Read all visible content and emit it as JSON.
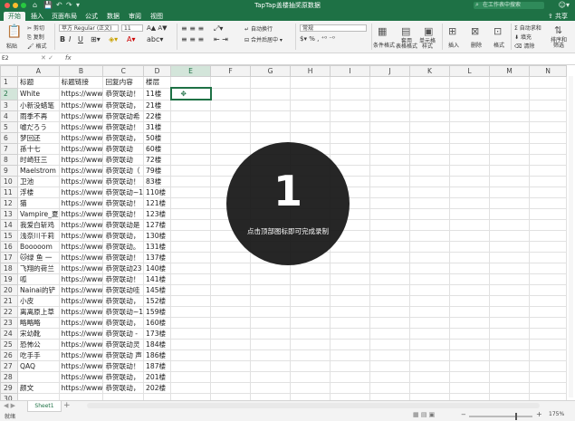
{
  "window": {
    "title": "TapTap盖楼抽奖原数据",
    "search_placeholder": "在工作表中搜索",
    "quick_access": [
      "⌂",
      "💾",
      "↶",
      "↷",
      "▾"
    ],
    "user_icon": "☺▾"
  },
  "tabs": [
    "开始",
    "插入",
    "页面布局",
    "公式",
    "数据",
    "审阅",
    "视图"
  ],
  "share_label": "⇪ 共享",
  "ribbon": {
    "paste": "粘贴",
    "cut": "剪切",
    "copy": "复制",
    "format_painter": "格式",
    "font_name": "苹方 Regular (正文)",
    "font_size": "11",
    "wrap": "自动换行",
    "merge": "合并后居中",
    "number_format": "常规",
    "cond_format": "条件格式",
    "table_format": "套用\n表格格式",
    "cell_styles": "单元格\n样式",
    "insert": "插入",
    "delete": "删除",
    "format": "格式",
    "autosum": "自动求和",
    "fill": "填充",
    "clear": "清除",
    "sort_filter": "排序和\n筛选"
  },
  "formula_bar": {
    "name_box": "E2",
    "fx": "fx",
    "formula": ""
  },
  "columns": [
    "A",
    "B",
    "C",
    "D",
    "E",
    "F",
    "G",
    "H",
    "I",
    "J",
    "K",
    "L",
    "M",
    "N"
  ],
  "rows": [
    {
      "n": "1",
      "a": "标题",
      "b": "标题链接",
      "c": "回复内容",
      "d": "楼层"
    },
    {
      "n": "2",
      "a": "White",
      "b": "https://www",
      "c": "恭贺联动！",
      "d": "11楼"
    },
    {
      "n": "3",
      "a": "小新没蜡笔",
      "b": "https://www",
      "c": "恭贺联动，",
      "d": "21楼"
    },
    {
      "n": "4",
      "a": "雨季不再",
      "b": "https://www",
      "c": "恭贺联动希",
      "d": "22楼"
    },
    {
      "n": "5",
      "a": "嘘だろう",
      "b": "https://www",
      "c": "恭贺联动！",
      "d": "31楼"
    },
    {
      "n": "6",
      "a": "梦回还",
      "b": "https://www",
      "c": "恭贺联动，",
      "d": "50楼"
    },
    {
      "n": "7",
      "a": "孫十七",
      "b": "https://www",
      "c": "恭贺联动",
      "d": "60楼"
    },
    {
      "n": "8",
      "a": "时崎狂三",
      "b": "https://www",
      "c": "恭贺联动",
      "d": "72楼"
    },
    {
      "n": "9",
      "a": "Maelstrom",
      "b": "https://www",
      "c": "恭贺联动（",
      "d": "79楼"
    },
    {
      "n": "10",
      "a": "卫池",
      "b": "https://www",
      "c": "恭贺联动！",
      "d": "83楼"
    },
    {
      "n": "11",
      "a": "浮楼",
      "b": "https://www",
      "c": "恭贺联动~1",
      "d": "110楼"
    },
    {
      "n": "12",
      "a": "猫",
      "b": "https://www",
      "c": "恭贺联动！",
      "d": "121楼"
    },
    {
      "n": "13",
      "a": "Vampire_夏",
      "b": "https://www",
      "c": "恭贺联动！",
      "d": "123楼"
    },
    {
      "n": "14",
      "a": "我爱白斩鸡",
      "b": "https://www",
      "c": "恭贺联动是",
      "d": "127楼"
    },
    {
      "n": "15",
      "a": "浅奈川千莉",
      "b": "https://www",
      "c": "恭贺联动，",
      "d": "130楼"
    },
    {
      "n": "16",
      "a": "Booooom",
      "b": "https://www",
      "c": "恭贺联动。",
      "d": "131楼"
    },
    {
      "n": "17",
      "a": "🐱绿 鱼 一",
      "b": "https://www",
      "c": "恭贺联动！",
      "d": "137楼"
    },
    {
      "n": "18",
      "a": "飞翔的荷兰",
      "b": "https://www",
      "c": "恭贺联动23",
      "d": "140楼"
    },
    {
      "n": "19",
      "a": "呱",
      "b": "https://www",
      "c": "恭贺联动！",
      "d": "141楼"
    },
    {
      "n": "20",
      "a": "Nainai的铲",
      "b": "https://www",
      "c": "恭贺联动哇",
      "d": "145楼"
    },
    {
      "n": "21",
      "a": "小皮",
      "b": "https://www",
      "c": "恭贺联动，",
      "d": "152楼"
    },
    {
      "n": "22",
      "a": "离离原上草",
      "b": "https://www",
      "c": "恭贺联动~1",
      "d": "159楼"
    },
    {
      "n": "23",
      "a": "略略略",
      "b": "https://www",
      "c": "恭贺联动，",
      "d": "160楼"
    },
    {
      "n": "24",
      "a": "宋幼靴",
      "b": "https://www",
      "c": "恭贺联动 -",
      "d": "173楼"
    },
    {
      "n": "25",
      "a": "恐怖公",
      "b": "https://www",
      "c": "恭贺联动灵",
      "d": "184楼"
    },
    {
      "n": "26",
      "a": "吃手手",
      "b": "https://www",
      "c": "恭贺联动 声",
      "d": "186楼"
    },
    {
      "n": "27",
      "a": "QAQ",
      "b": "https://www",
      "c": "恭贺联动！",
      "d": "187楼"
    },
    {
      "n": "28",
      "a": "",
      "b": "https://www",
      "c": "恭贺联动，",
      "d": "201楼"
    },
    {
      "n": "29",
      "a": "颜文",
      "b": "https://www",
      "c": "恭贺联动，",
      "d": "202楼"
    },
    {
      "n": "30",
      "a": "",
      "b": "",
      "c": "",
      "d": ""
    }
  ],
  "overlay": {
    "number": "1",
    "text": "点击顶部图标即可完成录制"
  },
  "status": {
    "ready": "就绪",
    "sheet_tab": "Sheet1",
    "add_sheet": "+",
    "zoom_minus": "−",
    "zoom_plus": "+",
    "zoom": "175%",
    "zoom_fraction": 0.75
  }
}
